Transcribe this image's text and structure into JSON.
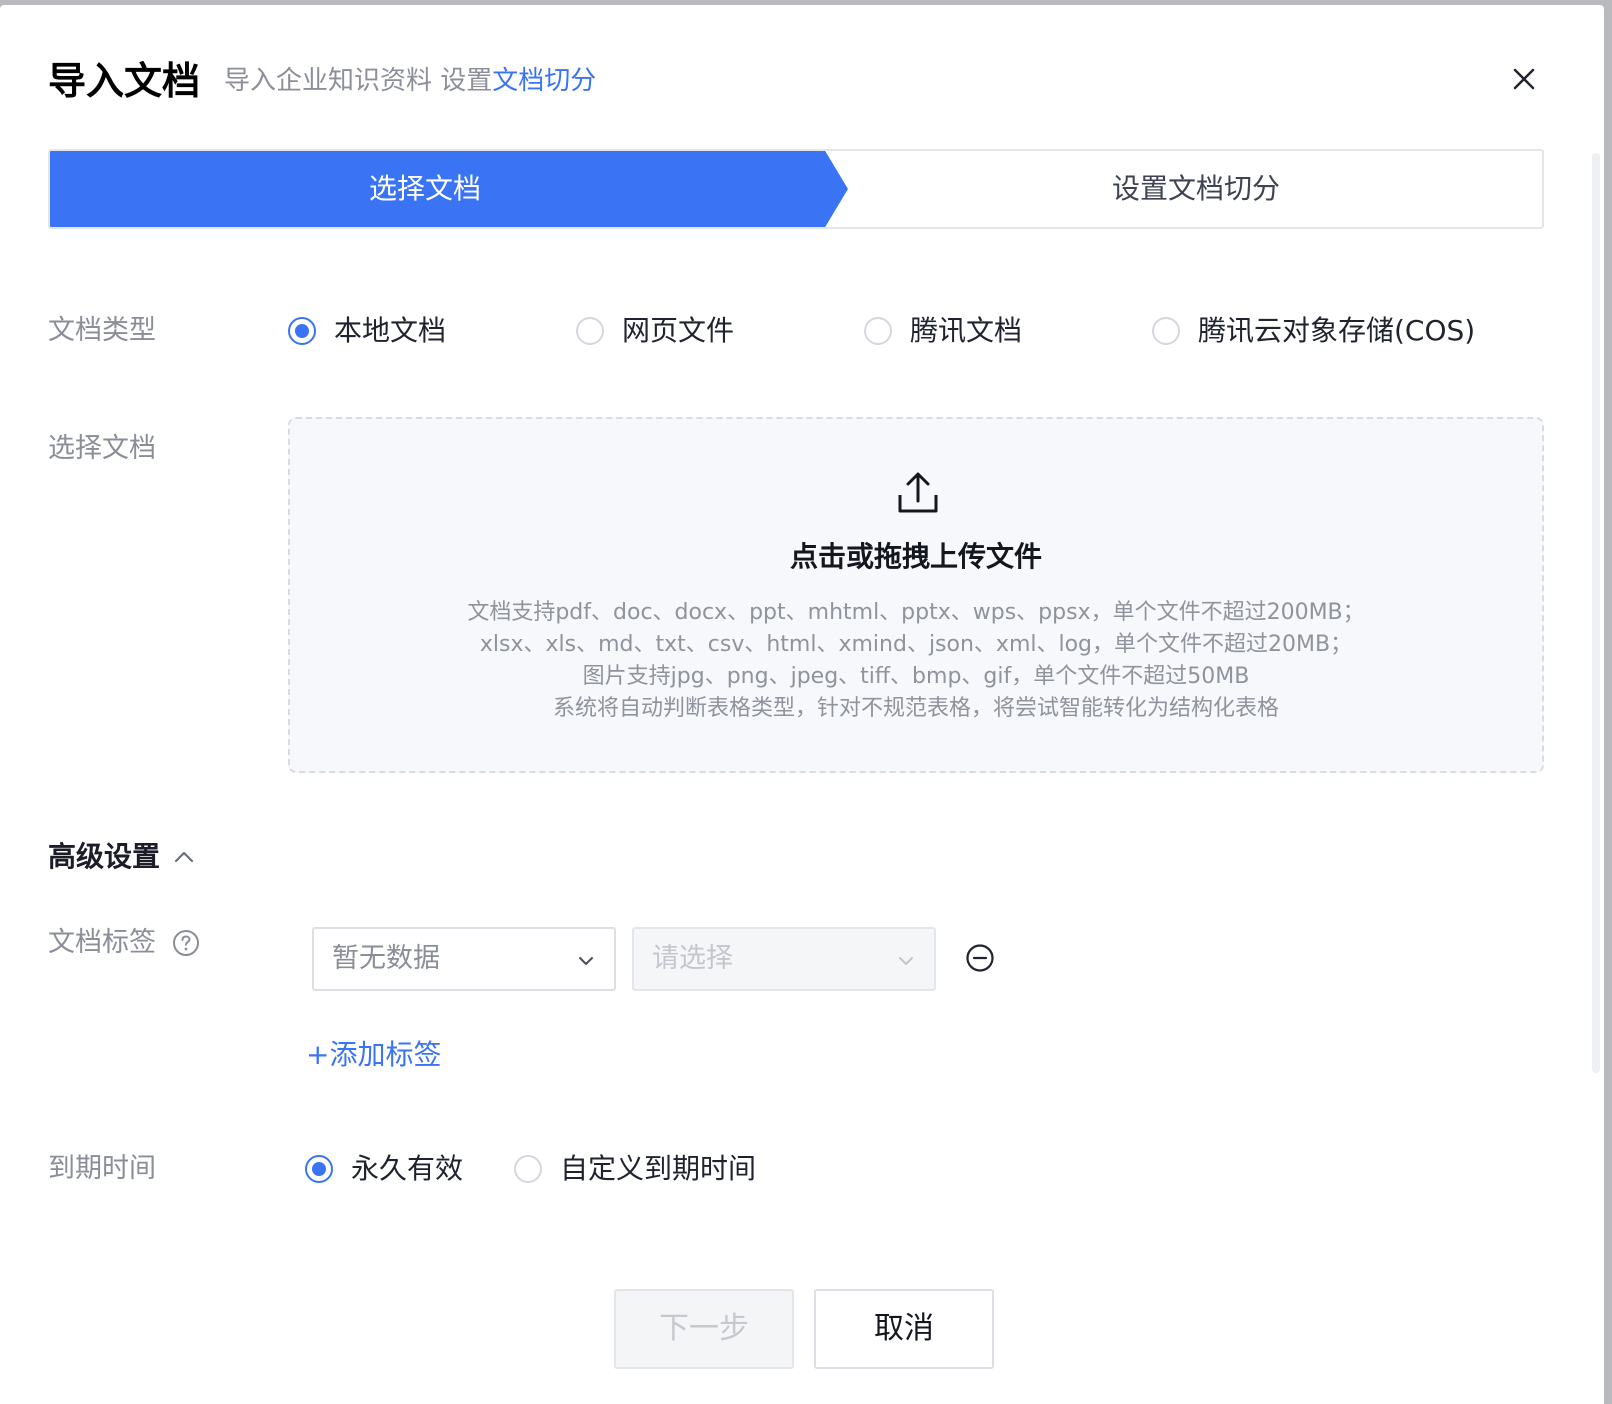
{
  "dialog": {
    "title": "导入文档",
    "subtitle_prefix": "导入企业知识资料 设置",
    "subtitle_link": "文档切分"
  },
  "steps": [
    {
      "label": "选择文档",
      "active": true
    },
    {
      "label": "设置文档切分",
      "active": false
    }
  ],
  "doc_type": {
    "label": "文档类型",
    "options": [
      {
        "label": "本地文档",
        "selected": true
      },
      {
        "label": "网页文件",
        "selected": false
      },
      {
        "label": "腾讯文档",
        "selected": false
      },
      {
        "label": "腾讯云对象存储(COS)",
        "selected": false
      }
    ]
  },
  "select_doc": {
    "label": "选择文档",
    "upload_title": "点击或拖拽上传文件",
    "upload_desc": [
      "文档支持pdf、doc、docx、ppt、mhtml、pptx、wps、ppsx，单个文件不超过200MB；",
      "xlsx、xls、md、txt、csv、html、xmind、json、xml、log，单个文件不超过20MB；",
      "图片支持jpg、png、jpeg、tiff、bmp、gif，单个文件不超过50MB",
      "系统将自动判断表格类型，针对不规范表格，将尝试智能转化为结构化表格"
    ]
  },
  "advanced": {
    "title": "高级设置",
    "tag_label": "文档标签",
    "tag_key_placeholder": "暂无数据",
    "tag_value_placeholder": "请选择",
    "add_tag": "+添加标签",
    "expiry_label": "到期时间",
    "expiry_options": [
      {
        "label": "永久有效",
        "selected": true
      },
      {
        "label": "自定义到期时间",
        "selected": false
      }
    ]
  },
  "footer": {
    "next": "下一步",
    "cancel": "取消"
  },
  "colors": {
    "primary": "#3a74f5",
    "muted_text": "#8a8e99"
  }
}
